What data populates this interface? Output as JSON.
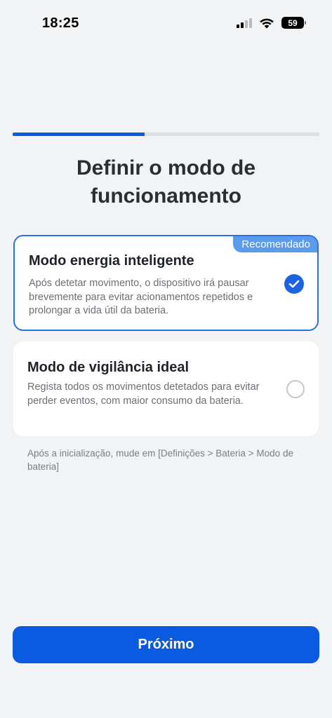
{
  "status_bar": {
    "time": "18:25",
    "battery_level": "59",
    "icons": [
      "cellular-signal-icon",
      "wifi-icon",
      "battery-icon"
    ]
  },
  "progress": {
    "value": 0.43
  },
  "page": {
    "title_line1": "Definir o modo de",
    "title_line2": "funcionamento"
  },
  "options": [
    {
      "title": "Modo energia inteligente",
      "description": "Após detetar movimento, o dispositivo irá pausar brevemente para evitar acionamentos repetidos e prolongar a vida útil da bateria.",
      "badge": "Recomendado",
      "selected": true
    },
    {
      "title": "Modo de vigilância ideal",
      "description": "Regista todos os movimentos detetados para evitar perder eventos, com maior consumo da bateria.",
      "selected": false
    }
  ],
  "note": "Após a inicialização, mude em [Definições > Bateria > Modo de bateria]",
  "next_button": {
    "label": "Próximo"
  },
  "colors": {
    "accent": "#0a5be0",
    "badge": "#5a9bec",
    "background": "#f2f3f5"
  }
}
